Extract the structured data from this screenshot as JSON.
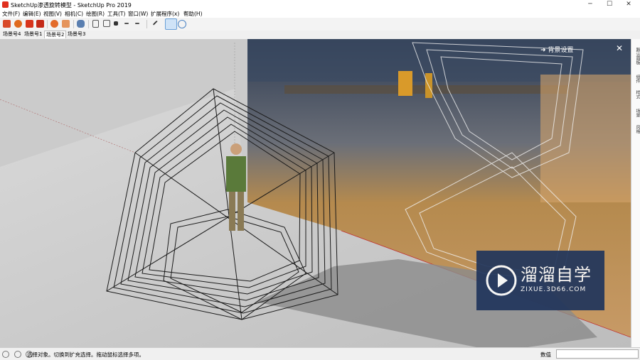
{
  "window": {
    "title": "SketchUp渗透旋转模型 - SketchUp Pro 2019",
    "minimize": "─",
    "maximize": "☐",
    "close": "✕"
  },
  "menu": [
    "文件(F)",
    "编辑(E)",
    "视图(V)",
    "相机(C)",
    "绘图(R)",
    "工具(T)",
    "窗口(W)",
    "扩展程序(x)",
    "帮助(H)"
  ],
  "scene_tabs": [
    "场景号4",
    "场景号1",
    "场景号2",
    "场景号3"
  ],
  "active_scene": "场景号2",
  "viewport": {
    "background_settings": "背景设置",
    "close": "✕"
  },
  "right_panel_tabs": [
    "默认面板",
    "组件",
    "样式",
    "场景",
    "风格"
  ],
  "status": {
    "message": "选择对象。切换到扩充选择。拖动鼠标选择多项。",
    "measurements_label": "数值",
    "measurements_value": ""
  },
  "watermark": {
    "name": "溜溜自学",
    "url": "ZIXUE.3D66.COM"
  },
  "colors": {
    "accent_red": "#e0301e",
    "watermark_bg": "#20355c"
  }
}
